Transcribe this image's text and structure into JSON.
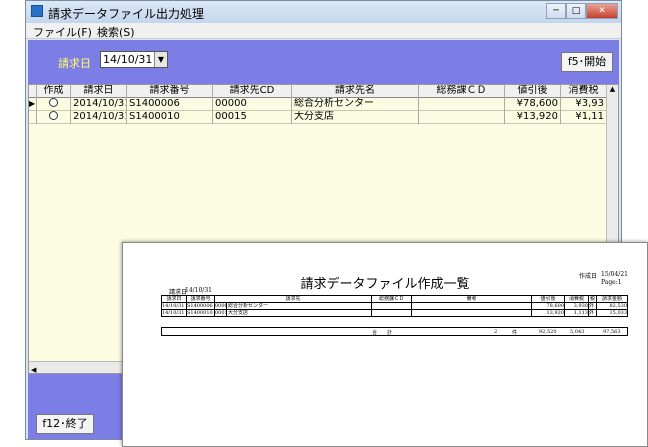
{
  "window": {
    "title": "請求データファイル出力処理",
    "btn_min": "─",
    "btn_max": "□",
    "btn_close": "✕"
  },
  "menu": [
    {
      "label": "ファイル(F)"
    },
    {
      "label": "検索(S)"
    }
  ],
  "filter": {
    "date_label": "請求日",
    "date_value": "14/10/31",
    "dropdown_glyph": "▼"
  },
  "buttons": {
    "start": "f5･開始",
    "exit": "f12･終了"
  },
  "grid": {
    "columns": [
      "作成",
      "請求日",
      "請求番号",
      "請求先CD",
      "請求先名",
      "総務課ＣＤ",
      "値引後",
      "消費税"
    ],
    "rows": [
      {
        "marker": "▶",
        "date": "2014/10/31",
        "no": "S1400006",
        "cd": "00000",
        "name": "総合分析センター",
        "dept": "",
        "amount": "¥78,600",
        "tax": "¥3,93"
      },
      {
        "marker": "",
        "date": "2014/10/31",
        "no": "S1400010",
        "cd": "00015",
        "name": "大分支店",
        "dept": "",
        "amount": "¥13,920",
        "tax": "¥1,11"
      }
    ],
    "scroll_up": "▲",
    "scroll_left": "◀"
  },
  "report": {
    "title": "請求データファイル作成一覧",
    "created_label": "作成日",
    "created_date": "15/04/21",
    "page": "Page:1",
    "date_label": "請求日",
    "date_value": "14/10/31",
    "columns": [
      "請求日",
      "請求番号",
      "請求先",
      "総務課ＣＤ",
      "備考",
      "値引後",
      "消費税",
      "税",
      "請求金額"
    ],
    "rows": [
      {
        "date": "14/10/31",
        "no": "S1400006",
        "cd": "00000",
        "name": "総合分析センター",
        "amount": "78,600",
        "tax": "3,930",
        "kind": "外",
        "total": "82,530"
      },
      {
        "date": "14/10/31",
        "no": "S1400010",
        "cd": "00015",
        "name": "大分支店",
        "amount": "13,920",
        "tax": "1,113",
        "kind": "外",
        "total": "15,033"
      }
    ],
    "total_label": "合　　計",
    "total_count": "2",
    "total_unit": "件",
    "total_amount": "92,520",
    "total_tax": "5,043",
    "total_grand": "97,563"
  }
}
